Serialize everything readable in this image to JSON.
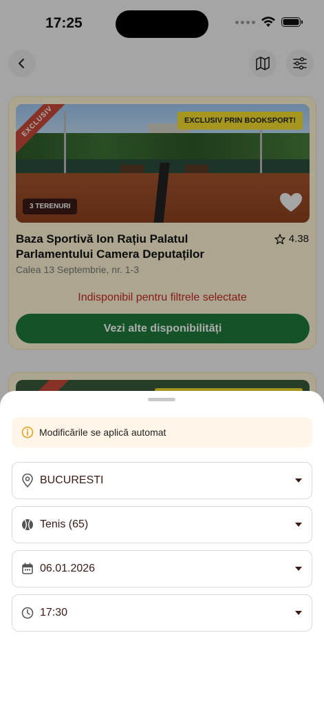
{
  "status_bar": {
    "time": "17:25"
  },
  "card": {
    "ribbon": "EXCLUSIV",
    "exclusive_tag": "EXCLUSIV PRIN BOOKSPORT!",
    "courts_tag": "3 TERENURI",
    "title": "Baza Sportivă Ion Rațiu Palatul Parlamentului Camera Deputaților",
    "rating": "4.38",
    "address": "Calea 13 Septembrie, nr. 1-3",
    "unavailable_text": "Indisponibil pentru filtrele selectate",
    "cta_label": "Vezi alte disponibilități"
  },
  "sheet": {
    "notice": "Modificările se aplică automat",
    "location": "BUCURESTI",
    "sport": "Tenis (65)",
    "date": "06.01.2026",
    "time": "17:30"
  },
  "colors": {
    "cta": "#1e7a3a",
    "unavailable": "#c62828",
    "exclusive_tag": "#f2dd2e",
    "ribbon": "#c94a3a",
    "card_bg": "#fef4d4"
  }
}
